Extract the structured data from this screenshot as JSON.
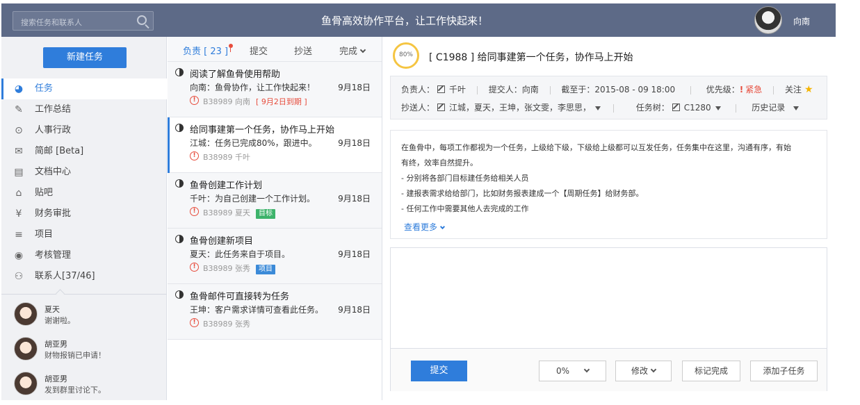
{
  "header": {
    "search_placeholder": "搜索任务和联系人",
    "slogan": "鱼骨高效协作平台，让工作快起来！",
    "username": "向南"
  },
  "sidebar": {
    "new_task_label": "新建任务",
    "items": [
      {
        "label": "任务",
        "icon": "pie-chart-icon",
        "glyph": "◕"
      },
      {
        "label": "工作总结",
        "icon": "pen-icon",
        "glyph": "✎"
      },
      {
        "label": "人事行政",
        "icon": "location-pin-icon",
        "glyph": "⊙"
      },
      {
        "label": "简邮 [Beta]",
        "icon": "mail-icon",
        "glyph": "✉"
      },
      {
        "label": "文档中心",
        "icon": "document-icon",
        "glyph": "▤"
      },
      {
        "label": "贴吧",
        "icon": "building-icon",
        "glyph": "⌂"
      },
      {
        "label": "财务审批",
        "icon": "yen-icon",
        "glyph": "¥"
      },
      {
        "label": "项目",
        "icon": "project-icon",
        "glyph": "≡"
      },
      {
        "label": "考核管理",
        "icon": "target-icon",
        "glyph": "◉"
      },
      {
        "label": "联系人[37/46]",
        "icon": "contacts-icon",
        "glyph": "⚇"
      }
    ],
    "contacts": [
      {
        "name": "夏天",
        "message": "谢谢啦。"
      },
      {
        "name": "胡亚男",
        "message": "财物报销已申请！"
      },
      {
        "name": "胡亚男",
        "message": "发到群里讨论下。"
      }
    ]
  },
  "tasklist": {
    "tabs": {
      "responsible": "负责 [ 23 ]",
      "submit": "提交",
      "cc": "抄送",
      "done": "完成"
    },
    "tasks": [
      {
        "title": "阅读了解鱼骨使用帮助",
        "desc": "向南：鱼骨协作，让工作快起来！",
        "date": "9月18日",
        "meta": "B38989 向南",
        "overdue": "[ 9月2日到期 ]",
        "badge": ""
      },
      {
        "title": "给同事建第一个任务，协作马上开始",
        "desc": "江城：任务已完成80%，跟进中。",
        "date": "9月18日",
        "meta": "B38989 千叶",
        "overdue": "",
        "badge": ""
      },
      {
        "title": "鱼骨创建工作计划",
        "desc": "千叶：为自己创建一个工作计划。",
        "date": "9月18日",
        "meta": "B38989 夏天",
        "overdue": "",
        "badge": "目标"
      },
      {
        "title": "鱼骨创建新项目",
        "desc": "夏天：此任务来自于项目。",
        "date": "9月18日",
        "meta": "B38989 张秀",
        "overdue": "",
        "badge": "项目"
      },
      {
        "title": "鱼骨邮件可直接转为任务",
        "desc": "王坤：客户需求详情可查看此任务。",
        "date": "9月18日",
        "meta": "B38989 张秀",
        "overdue": "",
        "badge": ""
      }
    ]
  },
  "detail": {
    "progress": "80%",
    "title": "[ C1988 ]  给同事建第一个任务，协作马上开始",
    "info": {
      "owner_label": "负责人：",
      "owner": "千叶",
      "submitter": "提交人：向南",
      "deadline": "截至于：2015-08 - 09 18:00",
      "priority_label": "优先级：",
      "priority": "紧急",
      "follow": "关注",
      "cc_label": "抄送人：",
      "cc": "江城，夏天，王坤，张文雯，李思思，",
      "tree_label": "任务树：",
      "tree": "C1280",
      "history": "历史记录"
    },
    "description": [
      "在鱼骨中，每项工作都视为一个任务，上级给下级，下级给上级都可以互发任务，任务集中在这里，沟通有序，有始",
      "有终，效率自然提升。",
      "- 分别将各部门目标建任务给相关人员",
      "- 建报表需求给给部门，比如财务报表建成一个【周期任务】给财务部。",
      "- 任何工作中需要其他人去完成的工作"
    ],
    "see_more": "查看更多",
    "toolbar": {
      "submit": "提交",
      "progress_value": "0%",
      "modify": "修改",
      "mark_done": "标记完成",
      "add_subtask": "添加子任务"
    }
  }
}
